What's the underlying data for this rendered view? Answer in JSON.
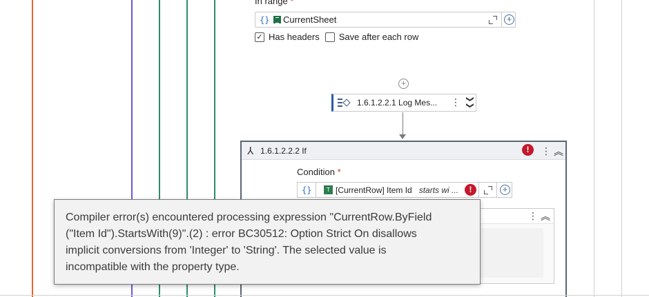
{
  "range_section": {
    "label": "In range",
    "required_mark": "*",
    "curly_label": "{}",
    "excel_icon": "excel-icon",
    "value": "CurrentSheet",
    "expand_icon": "expand-icon",
    "add_icon": "plus-circle-icon"
  },
  "options": {
    "has_headers": {
      "label": "Has headers",
      "checked": true,
      "mark": "✓"
    },
    "save_after_each_row": {
      "label": "Save after each row",
      "checked": false
    }
  },
  "add_activity": {
    "icon": "plus-circle-icon",
    "glyph": "+"
  },
  "log_message_card": {
    "title": "1.6.1.2.2.1  Log Mes...",
    "icon": "log-message-icon",
    "menu_glyph": "⋮",
    "expand_glyph": "❯❯"
  },
  "if_activity": {
    "icon_glyph": "⅄",
    "title": "1.6.1.2.2.2  If",
    "error_glyph": "!",
    "menu_glyph": "⋮",
    "collapse_glyph": "︽",
    "condition": {
      "label": "Condition",
      "required_mark": "*",
      "curly_label": "{}",
      "icon_text": "T",
      "value": "[CurrentRow] Item Id",
      "operator": "starts wi ...",
      "error_glyph": "!"
    },
    "inner_panel": {
      "menu_glyph": "⋮",
      "collapse_glyph": "︽"
    }
  },
  "tooltip": {
    "lines": [
      "Compiler error(s) encountered processing expression \"CurrentRow.ByField",
      "(\"Item Id\").StartsWith(9)\".(2) : error BC30512: Option Strict On disallows",
      "implicit conversions from 'Integer' to 'String'. The selected value is",
      "incompatible with the property type."
    ]
  },
  "colors": {
    "error": "#c4182b",
    "accent_blue": "#2a5aa8",
    "excel_green": "#1e7145",
    "orange_line": "#e8642a",
    "purple_line": "#6a5acd",
    "green_line": "#2e8b6a"
  }
}
